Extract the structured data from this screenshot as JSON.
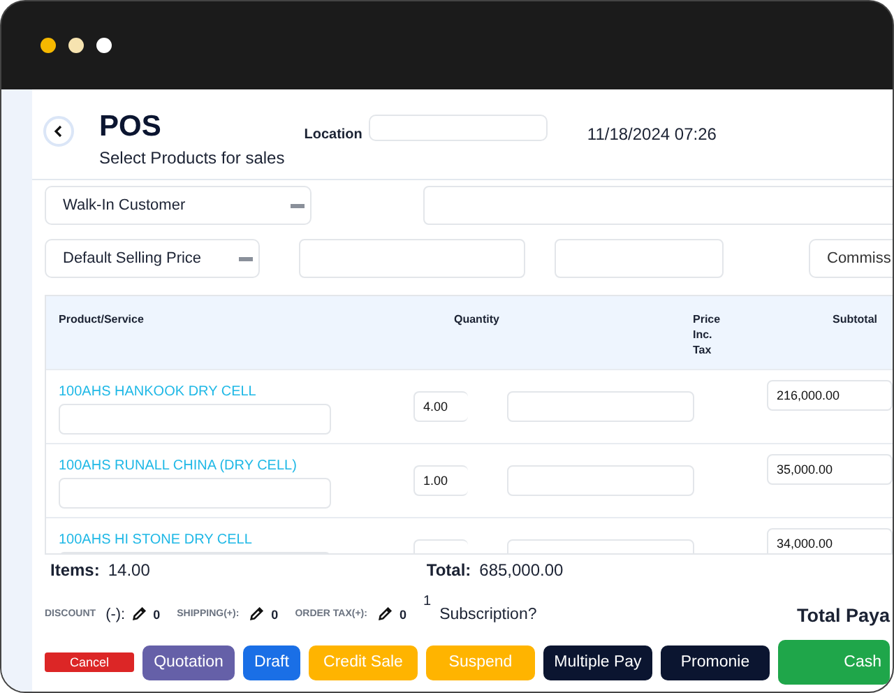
{
  "window": {
    "dots": [
      {
        "color": "#f5b800"
      },
      {
        "color": "#f6e3b0"
      },
      {
        "color": "#ffffff"
      }
    ]
  },
  "header": {
    "title": "POS",
    "subtitle": "Select Products for sales",
    "location_label": "Location",
    "datetime": "11/18/2024 07:26"
  },
  "customer": {
    "value": "Walk-In Customer"
  },
  "price_group": {
    "value": "Default Selling Price"
  },
  "commission": {
    "placeholder": "Commiss"
  },
  "table": {
    "columns": [
      "Product/Service",
      "Quantity",
      "Price\nInc.\nTax",
      "Subtotal"
    ],
    "rows": [
      {
        "product": "100AHS HANKOOK DRY CELL",
        "quantity": "4.00",
        "subtotal": "216,000.00"
      },
      {
        "product": "100AHS RUNALL CHINA (DRY CELL)",
        "quantity": "1.00",
        "subtotal": "35,000.00"
      },
      {
        "product": "100AHS HI STONE DRY CELL",
        "subtotal": "34,000.00"
      }
    ]
  },
  "totals": {
    "items_label": "Items:",
    "items": "14.00",
    "total_label": "Total:",
    "total": "685,000.00"
  },
  "adjustments": [
    {
      "label": "DISCOUNT",
      "sign": "(-):",
      "value": "0"
    },
    {
      "label": "SHIPPING(+):",
      "value": "0"
    },
    {
      "label": "ORDER TAX(+):",
      "value": "0"
    }
  ],
  "subscription": {
    "count": "1",
    "label": "Subscription?"
  },
  "total_payable_label": "Total Paya",
  "buttons": [
    {
      "label": "Cancel",
      "color": "#dc2626"
    },
    {
      "label": "Quotation",
      "color": "#6560a8"
    },
    {
      "label": "Draft",
      "color": "#1a6fe6"
    },
    {
      "label": "Credit Sale",
      "color": "#ffb400"
    },
    {
      "label": "Suspend",
      "color": "#ffb400"
    },
    {
      "label": "Multiple Pay",
      "color": "#0b1530"
    },
    {
      "label": "Promonie",
      "color": "#0b1530"
    },
    {
      "label": "Cash",
      "color": "#1fa64a"
    }
  ]
}
